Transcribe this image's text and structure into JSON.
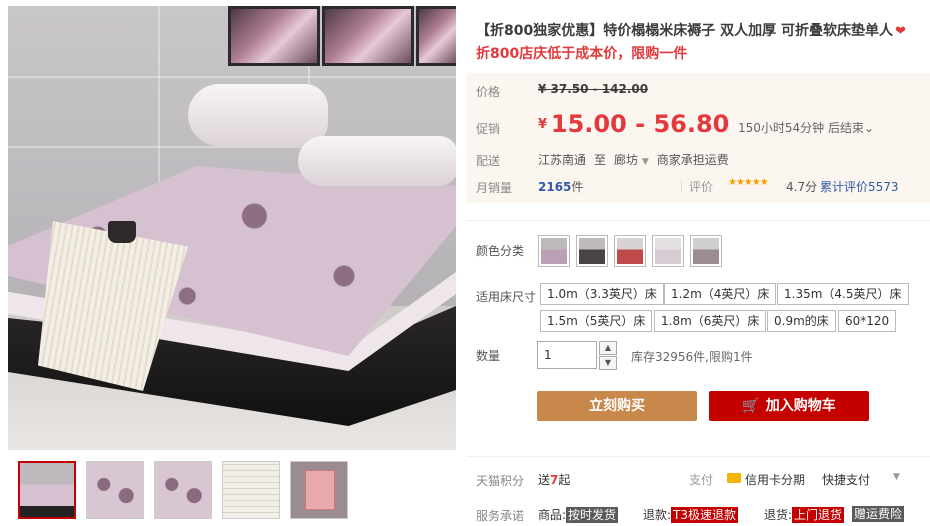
{
  "product": {
    "title": "【折800独家优惠】特价榻榻米床褥子 双人加厚 可折叠软床垫单人",
    "heart_icon": "heart-icon",
    "subtitle": "折800店庆低于成本价，限购一件"
  },
  "price": {
    "label": "价格",
    "original": "¥ 37.50 - 142.00",
    "promo_label": "促销",
    "promo_currency": "¥",
    "promo_value": "15.00 - 56.80",
    "promo_time": "150小时54分钟 后结束",
    "promo_time_caret": "⌄"
  },
  "shipping": {
    "label": "配送",
    "from": "江苏南通",
    "to_word": "至",
    "to": "廊坊",
    "fee": "商家承担运费"
  },
  "sales": {
    "label": "月销量",
    "count": "2165",
    "unit": "件",
    "rating_label": "评价",
    "stars": "★★★★★",
    "score": "4.7分",
    "reviews": "累计评价5573"
  },
  "color": {
    "label": "颜色分类",
    "options": [
      "#b9a0b4",
      "#4a4448",
      "#c04a4a",
      "#d8ccd4",
      "#9a8c90"
    ]
  },
  "size": {
    "label": "适用床尺寸",
    "options": [
      "1.0m（3.3英尺）床",
      "1.2m（4英尺）床",
      "1.35m（4.5英尺）床",
      "1.5m（5英尺）床",
      "1.8m（6英尺）床",
      "0.9m的床",
      "60*120"
    ]
  },
  "quantity": {
    "label": "数量",
    "value": "1",
    "up": "▲",
    "down": "▼",
    "stock": "库存32956件,限购1件"
  },
  "actions": {
    "buy_now": "立刻购买",
    "add_to_cart": "加入购物车",
    "cart_icon": "🛒"
  },
  "points": {
    "label": "天猫积分",
    "give": "送",
    "amount": "7",
    "unit": "起"
  },
  "payment": {
    "label": "支付",
    "card": "信用卡分期",
    "fast": "快捷支付",
    "caret": "▼"
  },
  "promise": {
    "label": "服务承诺",
    "goods": "商品:",
    "goods_tag": "按时发货",
    "refund": "退款:",
    "refund_tag": "T3极速退款",
    "return": "退货:",
    "return_tag": "上门退货",
    "extra_tag": "赠运费险"
  }
}
